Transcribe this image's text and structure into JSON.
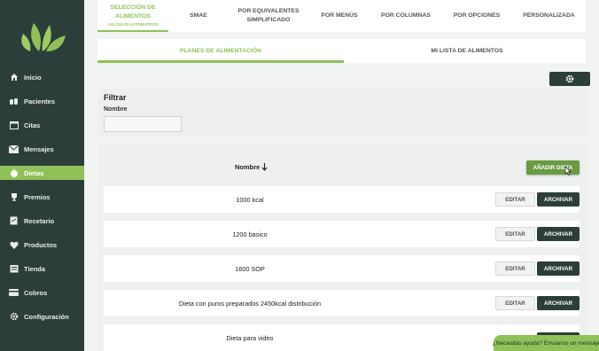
{
  "sidebar": {
    "items": [
      {
        "label": "Inicio",
        "icon": "home-icon"
      },
      {
        "label": "Pacientes",
        "icon": "users-icon"
      },
      {
        "label": "Citas",
        "icon": "calendar-icon"
      },
      {
        "label": "Mensajes",
        "icon": "mail-icon"
      },
      {
        "label": "Dietas",
        "icon": "apple-icon"
      },
      {
        "label": "Premios",
        "icon": "trophy-icon"
      },
      {
        "label": "Recetario",
        "icon": "recipe-book-icon"
      },
      {
        "label": "Productos",
        "icon": "heart-icon"
      },
      {
        "label": "Tienda",
        "icon": "store-icon"
      },
      {
        "label": "Cobros",
        "icon": "credit-card-icon"
      },
      {
        "label": "Configuración",
        "icon": "gear-icon"
      }
    ],
    "active": "Dietas"
  },
  "top_tabs": [
    {
      "line1": "SELECCIÓN DE",
      "line2": "ALIMENTOS",
      "sub": "CALCULOS AUTOMATICOS"
    },
    {
      "line1": "SMAE"
    },
    {
      "line1": "POR EQUIVALENTES",
      "line2": "SIMPLIFICADO"
    },
    {
      "line1": "POR MENÚS"
    },
    {
      "line1": "POR COLUMNAS"
    },
    {
      "line1": "POR OPCIONES"
    },
    {
      "line1": "PERSONALIZADA"
    }
  ],
  "sub_tabs": [
    "PLANES DE ALIMENTACIÓN",
    "MI LISTA DE ALIMENTOS"
  ],
  "filter": {
    "title": "Filtrar",
    "name_label": "Nombre",
    "name_value": ""
  },
  "list": {
    "column_header": "Nombre",
    "add_button": "AÑADIR DIETA",
    "edit_label": "EDITAR",
    "archive_label": "ARCHIVAR",
    "rows": [
      "1000 kcal",
      "1200 basico",
      "1600 SOP",
      "Dieta con puros preparados 2450kcal distribución",
      "Dieta para video"
    ]
  },
  "help_chat": "¿Necesitas ayuda? Envíanos un mensaje",
  "colors": {
    "sidebar": "#2c3e3a",
    "accent": "#8fc158",
    "dark_button": "#2c3e3a"
  }
}
